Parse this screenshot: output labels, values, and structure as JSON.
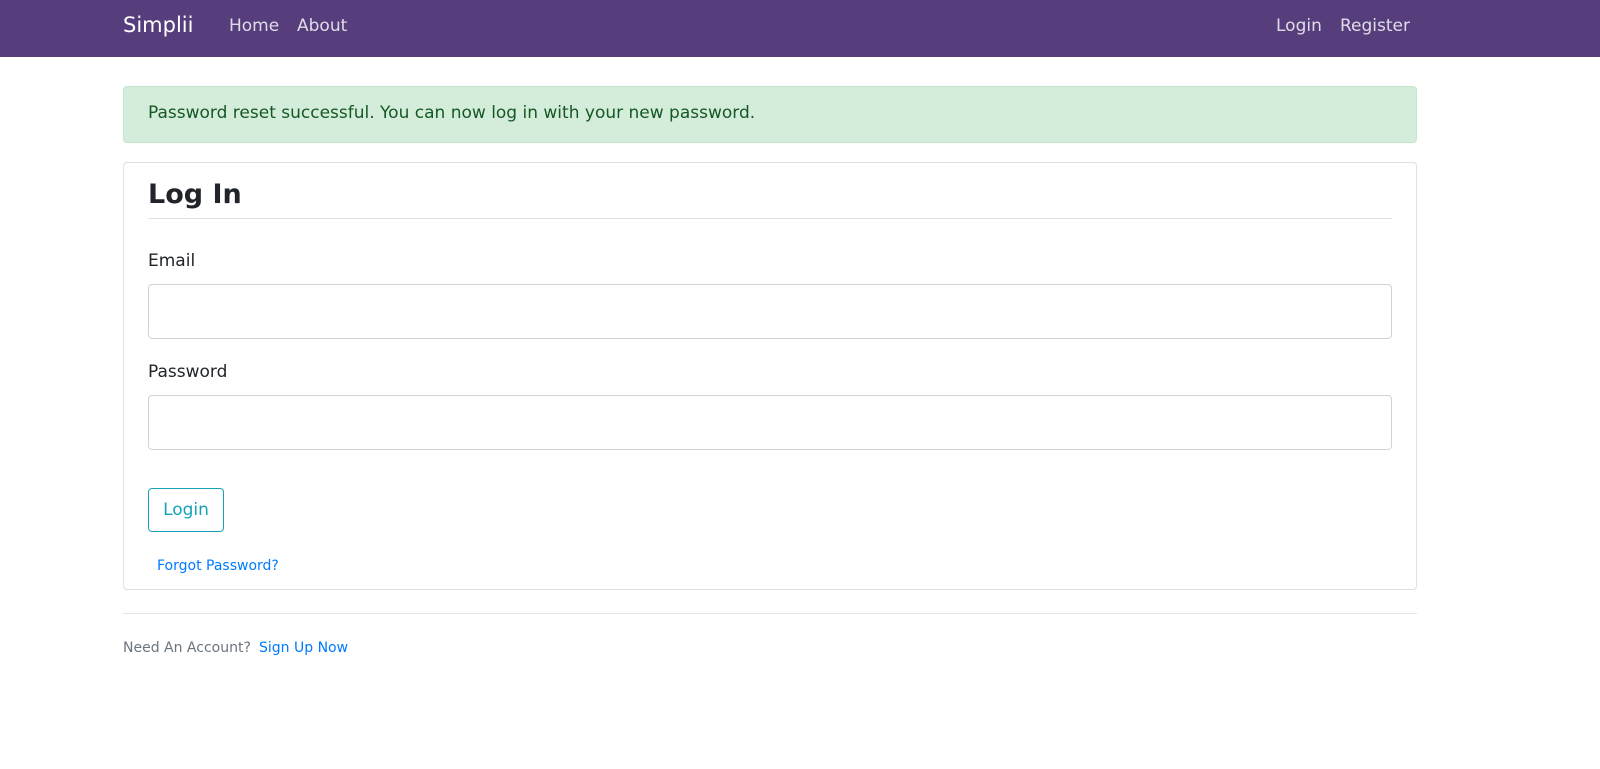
{
  "navbar": {
    "brand": "Simplii",
    "links": {
      "home": "Home",
      "about": "About",
      "login": "Login",
      "register": "Register"
    },
    "background_color": "#563d7c"
  },
  "alert": {
    "message": "Password reset successful. You can now log in with your new password.",
    "type": "success",
    "background_color": "#d4edda",
    "text_color": "#155724"
  },
  "login_form": {
    "title": "Log In",
    "email": {
      "label": "Email",
      "value": "",
      "placeholder": ""
    },
    "password": {
      "label": "Password",
      "value": "",
      "placeholder": ""
    },
    "submit_label": "Login",
    "submit_color": "#17a2b8",
    "forgot_password_link": "Forgot Password?"
  },
  "footer": {
    "prompt": "Need An Account?",
    "signup_link": "Sign Up Now",
    "link_color": "#007bff"
  }
}
